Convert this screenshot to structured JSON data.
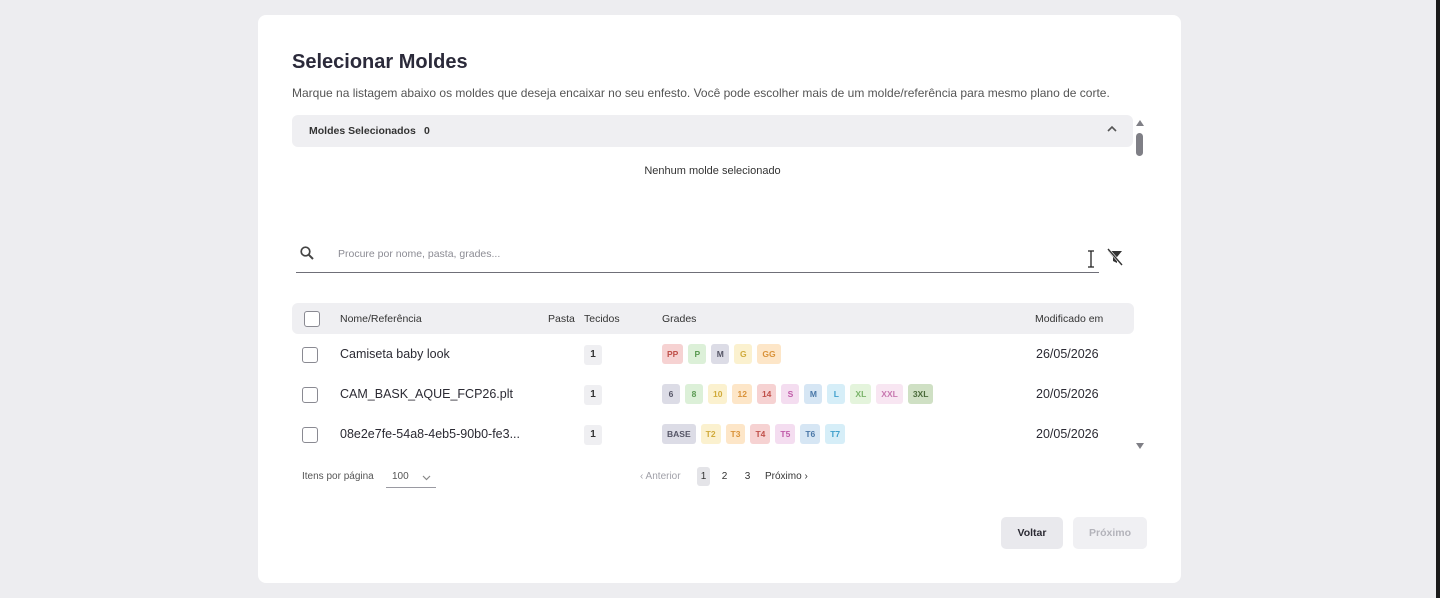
{
  "modal": {
    "title": "Selecionar Moldes",
    "subtitle": "Marque na listagem abaixo os moldes que deseja encaixar no seu enfesto. Você pode escolher mais de um molde/referência para mesmo plano de corte."
  },
  "selected": {
    "label": "Moldes Selecionados",
    "count": "0",
    "empty_message": "Nenhum molde selecionado"
  },
  "search": {
    "placeholder": "Procure por nome, pasta, grades...",
    "value": ""
  },
  "table": {
    "headers": {
      "name": "Nome/Referência",
      "folder": "Pasta",
      "fabrics": "Tecidos",
      "grades": "Grades",
      "modified": "Modificado em"
    },
    "rows": [
      {
        "name": "Camiseta baby look",
        "fabrics": "1",
        "date": "26/05/2026",
        "grades": [
          {
            "label": "PP",
            "bg": "#f6d2d2",
            "fg": "#c0504a"
          },
          {
            "label": "P",
            "bg": "#dcf0d8",
            "fg": "#5a9a52"
          },
          {
            "label": "M",
            "bg": "#dcdce6",
            "fg": "#555566"
          },
          {
            "label": "G",
            "bg": "#fbf1cf",
            "fg": "#d0aa3a"
          },
          {
            "label": "GG",
            "bg": "#fde6c8",
            "fg": "#d9923a"
          }
        ]
      },
      {
        "name": "CAM_BASK_AQUE_FCP26.plt",
        "fabrics": "1",
        "date": "20/05/2026",
        "grades": [
          {
            "label": "6",
            "bg": "#dcdce6",
            "fg": "#555566"
          },
          {
            "label": "8",
            "bg": "#dcf0d8",
            "fg": "#5a9a52"
          },
          {
            "label": "10",
            "bg": "#fbf1cf",
            "fg": "#d0aa3a"
          },
          {
            "label": "12",
            "bg": "#fde6c8",
            "fg": "#d9923a"
          },
          {
            "label": "14",
            "bg": "#f6d2d2",
            "fg": "#c0504a"
          },
          {
            "label": "S",
            "bg": "#f4ddf0",
            "fg": "#c05aa8"
          },
          {
            "label": "M",
            "bg": "#d6e6f4",
            "fg": "#4a78a8"
          },
          {
            "label": "L",
            "bg": "#d6eef8",
            "fg": "#3fa0cc"
          },
          {
            "label": "XL",
            "bg": "#e4f4dc",
            "fg": "#7ab46a"
          },
          {
            "label": "XXL",
            "bg": "#f8e6f2",
            "fg": "#c878b0"
          },
          {
            "label": "3XL",
            "bg": "#cfe0c4",
            "fg": "#4a6a3a"
          }
        ]
      },
      {
        "name": "08e2e7fe-54a8-4eb5-90b0-fe3...",
        "fabrics": "1",
        "date": "20/05/2026",
        "grades": [
          {
            "label": "BASE",
            "bg": "#dcdce6",
            "fg": "#555566"
          },
          {
            "label": "T2",
            "bg": "#fbf1cf",
            "fg": "#d0aa3a"
          },
          {
            "label": "T3",
            "bg": "#fde6c8",
            "fg": "#d9923a"
          },
          {
            "label": "T4",
            "bg": "#f6d2d2",
            "fg": "#c0504a"
          },
          {
            "label": "T5",
            "bg": "#f4ddf0",
            "fg": "#c05aa8"
          },
          {
            "label": "T6",
            "bg": "#d6e6f4",
            "fg": "#4a78a8"
          },
          {
            "label": "T7",
            "bg": "#d6eef8",
            "fg": "#3fa0cc"
          }
        ]
      }
    ]
  },
  "pagination": {
    "items_label": "Itens por página",
    "items_value": "100",
    "prev": "‹ Anterior",
    "pages": [
      "1",
      "2",
      "3"
    ],
    "current": "1",
    "next": "Próximo ›"
  },
  "actions": {
    "back": "Voltar",
    "next": "Próximo"
  },
  "icons": {
    "search": "search-icon",
    "filter_off": "filter-off-icon",
    "chevron_up": "chevron-up-icon",
    "chevron_down": "chevron-down-icon",
    "text_cursor": "text-cursor-icon"
  }
}
